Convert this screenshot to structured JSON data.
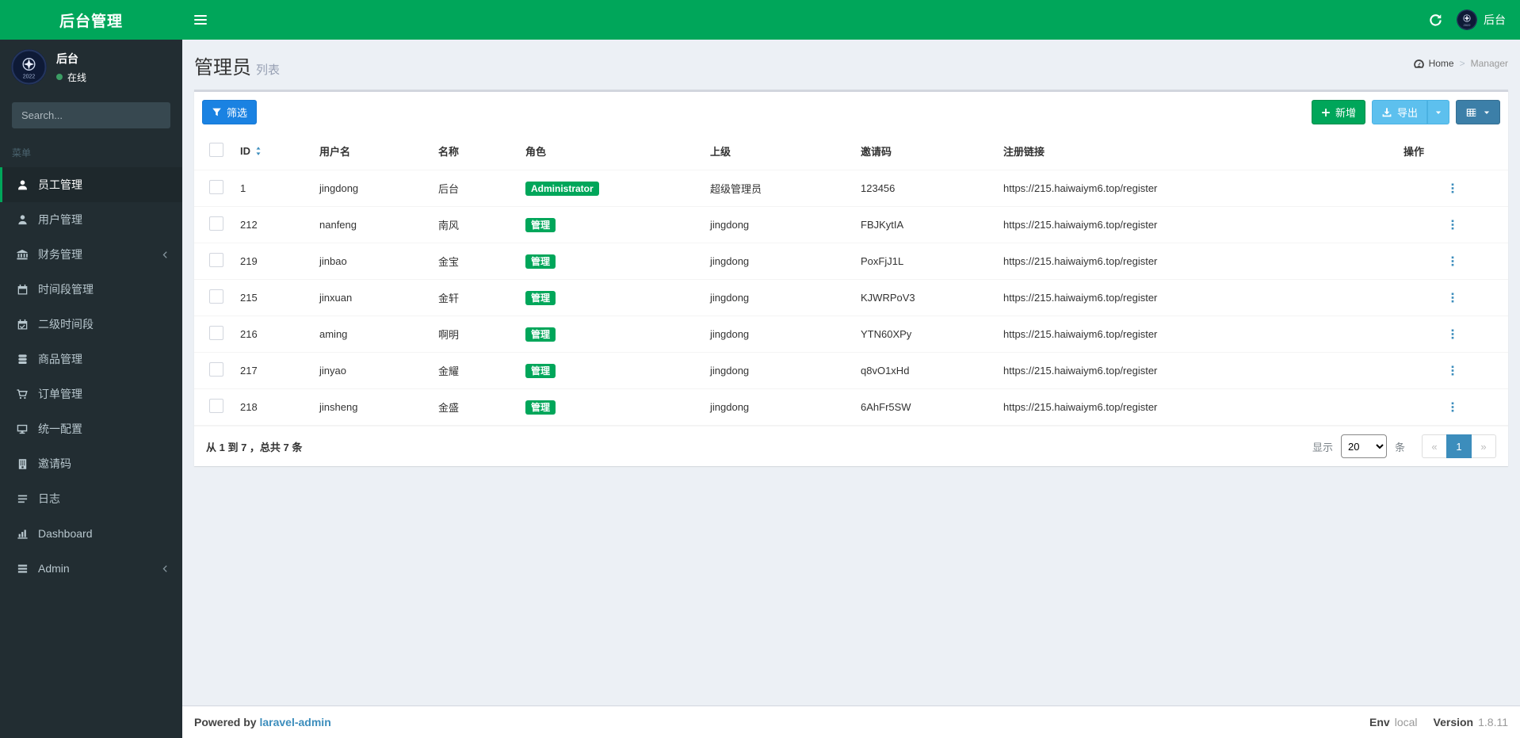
{
  "colors": {
    "accent": "#00a65a",
    "filter_button": "#1a82e2",
    "export_button": "#5dc0ee",
    "grid_button": "#3c7fa8",
    "pagination_active": "#3c8dbc",
    "badge": "#00a65a",
    "sidebar": "#222d32"
  },
  "navbar": {
    "logo": "后台管理",
    "username": "后台"
  },
  "sidebar": {
    "user": {
      "name": "后台",
      "status": "在线"
    },
    "search_placeholder": "Search...",
    "menu_header": "菜单",
    "items": [
      {
        "label": "员工管理",
        "icon": "user",
        "active": true,
        "chevron": false
      },
      {
        "label": "用户管理",
        "icon": "user2",
        "active": false,
        "chevron": false
      },
      {
        "label": "财务管理",
        "icon": "bank",
        "active": false,
        "chevron": true
      },
      {
        "label": "时间段管理",
        "icon": "calendar",
        "active": false,
        "chevron": false
      },
      {
        "label": "二级时间段",
        "icon": "calendar-check",
        "active": false,
        "chevron": false
      },
      {
        "label": "商品管理",
        "icon": "database",
        "active": false,
        "chevron": false
      },
      {
        "label": "订单管理",
        "icon": "cart",
        "active": false,
        "chevron": false
      },
      {
        "label": "统一配置",
        "icon": "desktop",
        "active": false,
        "chevron": false
      },
      {
        "label": "邀请码",
        "icon": "book",
        "active": false,
        "chevron": false
      },
      {
        "label": "日志",
        "icon": "list",
        "active": false,
        "chevron": false
      },
      {
        "label": "Dashboard",
        "icon": "chart",
        "active": false,
        "chevron": false
      },
      {
        "label": "Admin",
        "icon": "tasks",
        "active": false,
        "chevron": true
      }
    ]
  },
  "page": {
    "title": "管理员",
    "subtitle": "列表",
    "breadcrumb": {
      "home": "Home",
      "current": "Manager",
      "separator": ">"
    }
  },
  "toolbar": {
    "filter": "筛选",
    "add": "新增",
    "export": "导出"
  },
  "table": {
    "columns": [
      "ID",
      "用户名",
      "名称",
      "角色",
      "上级",
      "邀请码",
      "注册链接",
      "操作"
    ],
    "rows": [
      {
        "id": "1",
        "username": "jingdong",
        "name": "后台",
        "role": "Administrator",
        "parent": "超级管理员",
        "invite_code": "123456",
        "register_link": "https://215.haiwaiym6.top/register"
      },
      {
        "id": "212",
        "username": "nanfeng",
        "name": "南风",
        "role": "管理",
        "parent": "jingdong",
        "invite_code": "FBJKytIA",
        "register_link": "https://215.haiwaiym6.top/register"
      },
      {
        "id": "219",
        "username": "jinbao",
        "name": "金宝",
        "role": "管理",
        "parent": "jingdong",
        "invite_code": "PoxFjJ1L",
        "register_link": "https://215.haiwaiym6.top/register"
      },
      {
        "id": "215",
        "username": "jinxuan",
        "name": "金轩",
        "role": "管理",
        "parent": "jingdong",
        "invite_code": "KJWRPoV3",
        "register_link": "https://215.haiwaiym6.top/register"
      },
      {
        "id": "216",
        "username": "aming",
        "name": "啊明",
        "role": "管理",
        "parent": "jingdong",
        "invite_code": "YTN60XPy",
        "register_link": "https://215.haiwaiym6.top/register"
      },
      {
        "id": "217",
        "username": "jinyao",
        "name": "金耀",
        "role": "管理",
        "parent": "jingdong",
        "invite_code": "q8vO1xHd",
        "register_link": "https://215.haiwaiym6.top/register"
      },
      {
        "id": "218",
        "username": "jinsheng",
        "name": "金盛",
        "role": "管理",
        "parent": "jingdong",
        "invite_code": "6AhFr5SW",
        "register_link": "https://215.haiwaiym6.top/register"
      }
    ],
    "summary": "从 1 到 7 ，总共 7 条",
    "page_size_prefix": "显示",
    "page_size": "20",
    "page_size_suffix": "条",
    "pagination": {
      "prev": "«",
      "current": "1",
      "next": "»"
    }
  },
  "footer": {
    "powered_by": "Powered by",
    "powered_link": "laravel-admin",
    "env_label": "Env",
    "env_value": "local",
    "version_label": "Version",
    "version_value": "1.8.11"
  }
}
